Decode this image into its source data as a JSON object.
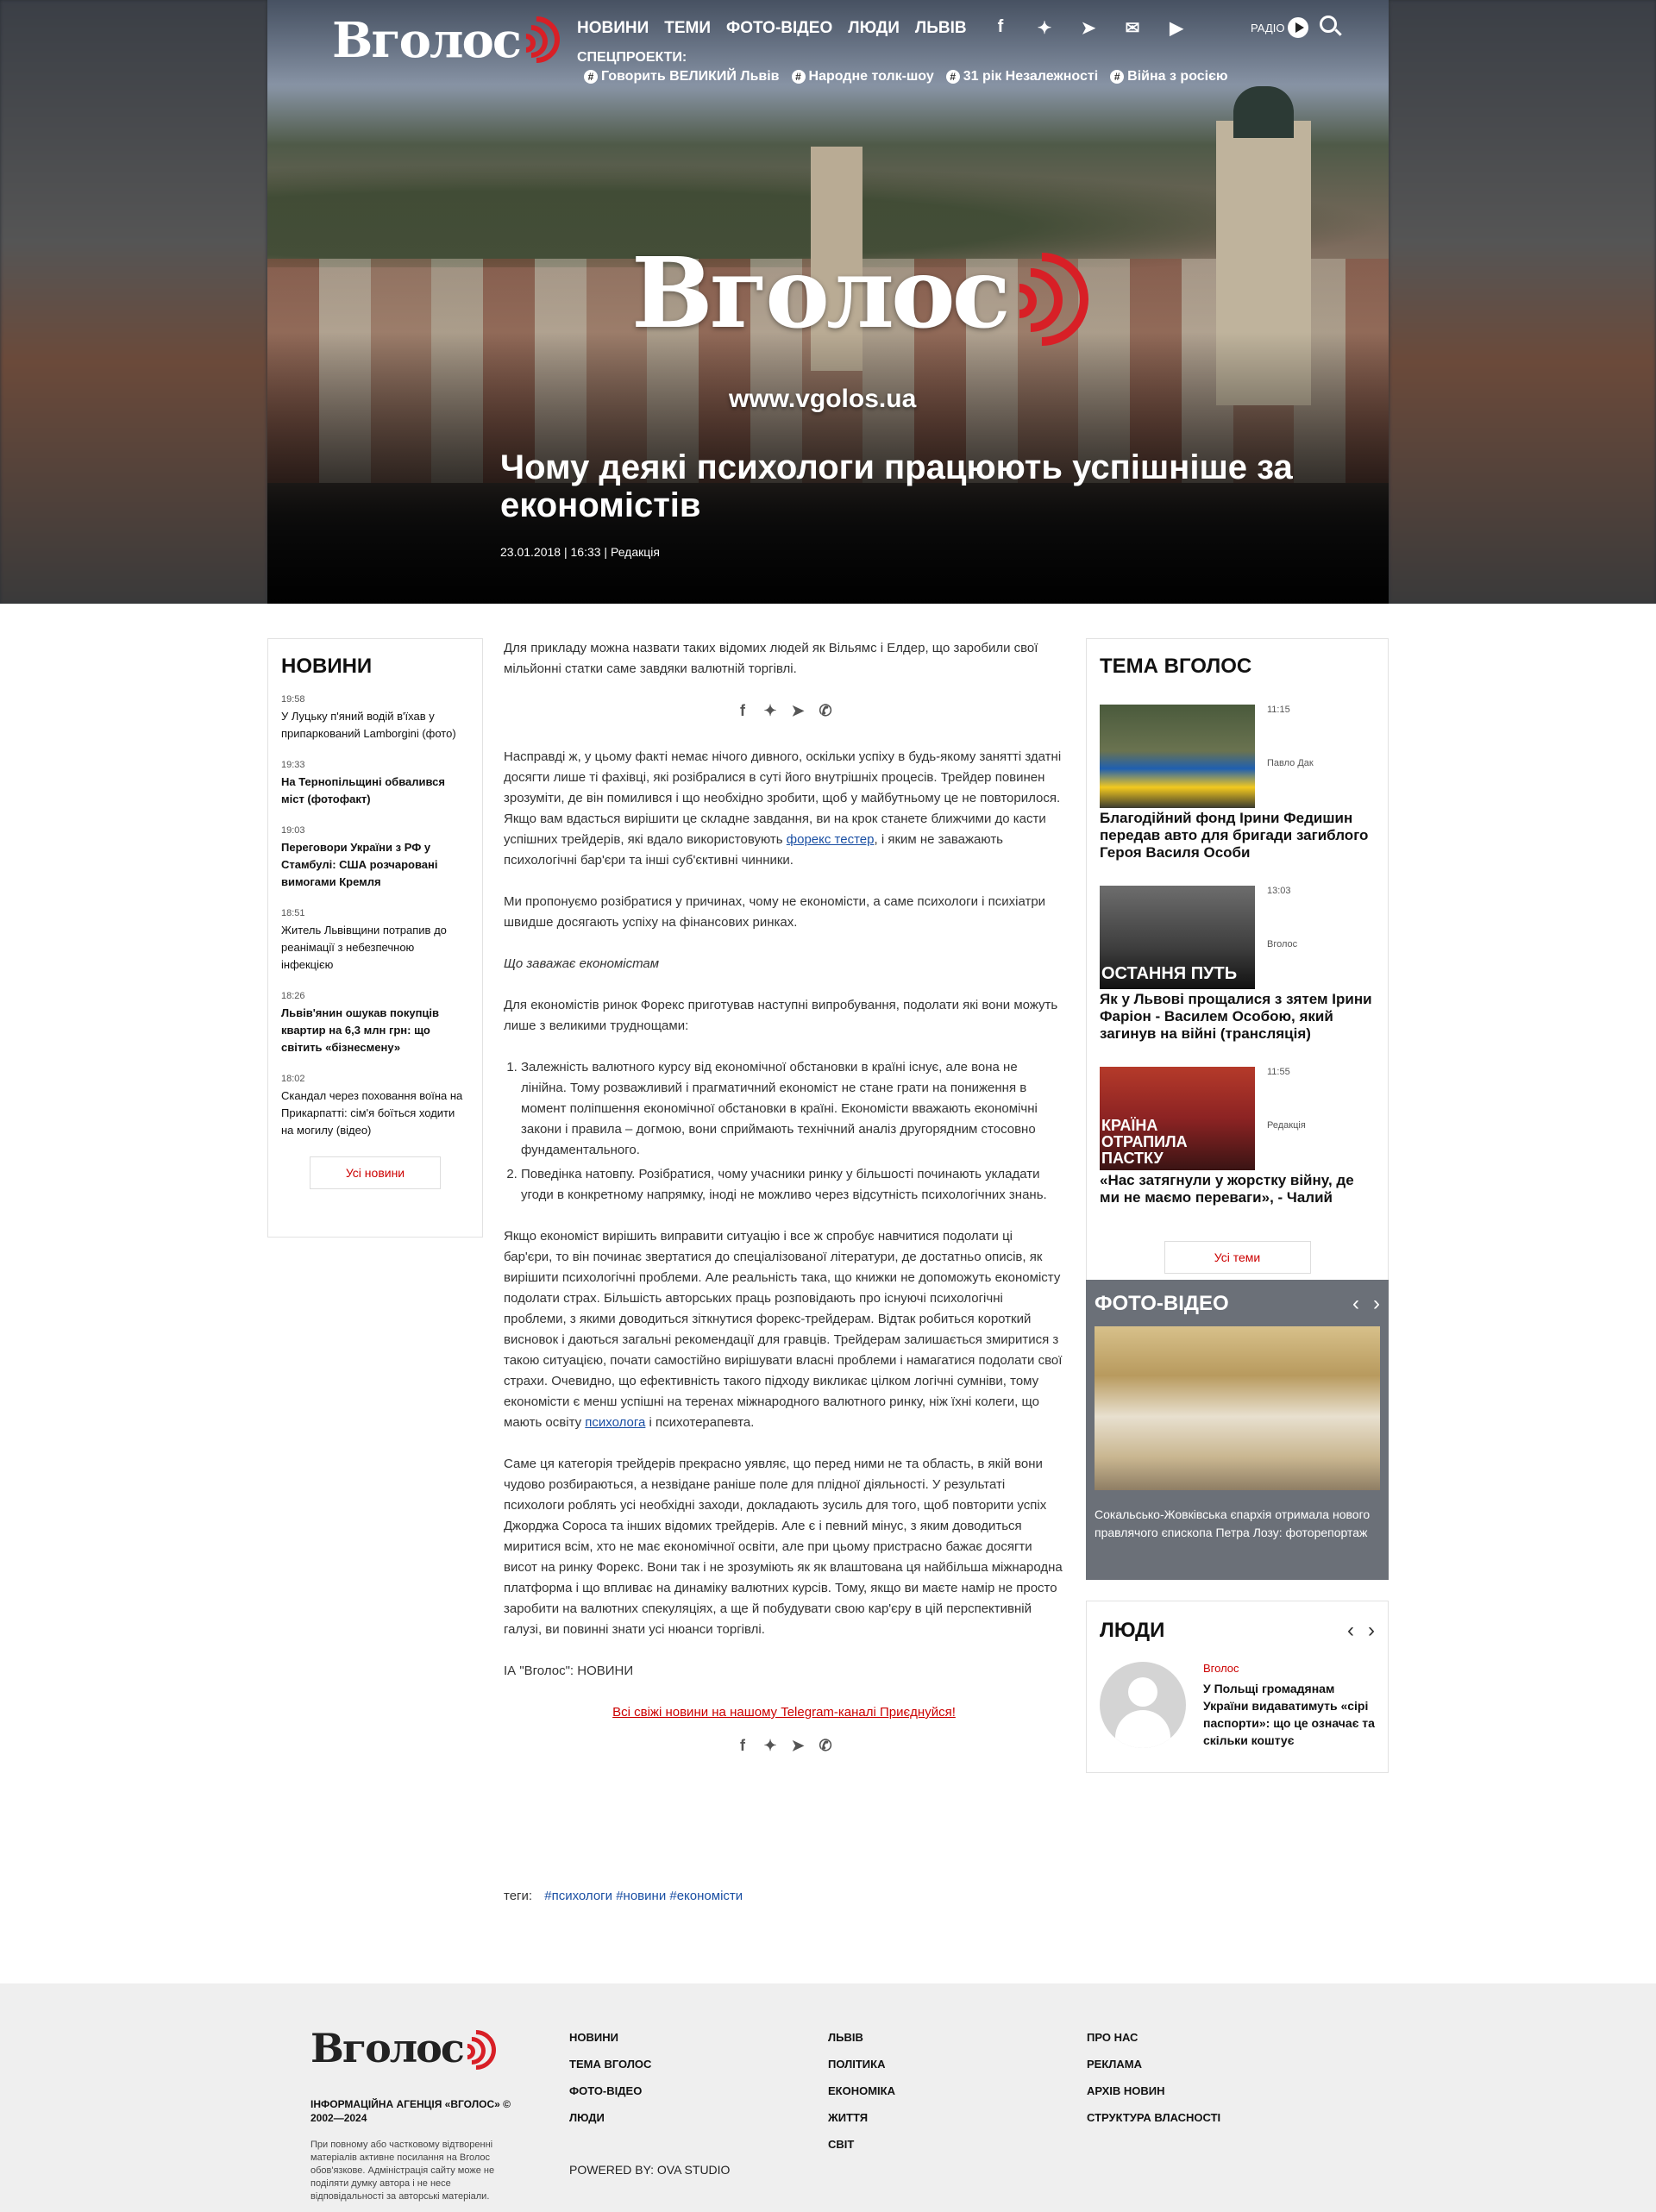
{
  "header": {
    "logo": "Вголос",
    "nav": [
      "Новини",
      "Теми",
      "Фото-відео",
      "Люди",
      "Львів"
    ],
    "social_icons": [
      "facebook-icon",
      "twitter-icon",
      "telegram-icon",
      "mail-icon",
      "youtube-icon"
    ],
    "radio_label": "Радіо",
    "special_label": "Спецпроекти:",
    "special_projects": [
      "Говорить ВЕЛИКИЙ Львів",
      "Народне толк-шоу",
      "31 рік Незалежності",
      "Війна з росією"
    ]
  },
  "hero": {
    "brand": "Вголос",
    "url": "www.vgolos.ua",
    "title": "Чому деякі психологи працюють успішніше за економістів",
    "date": "23.01.2018",
    "time": "16:33",
    "author": "Редакція"
  },
  "news_widget": {
    "title": "Новини",
    "items": [
      {
        "time": "19:58",
        "text": "У Луцьку п'яний водій в'їхав у припаркований Lamborgini (фото)",
        "bold": false
      },
      {
        "time": "19:33",
        "text": "На Тернопільщині обвалився міст (фотофакт)",
        "bold": true
      },
      {
        "time": "19:03",
        "text": "Переговори України з РФ у Стамбулі: США розчаровані вимогами Кремля",
        "bold": true
      },
      {
        "time": "18:51",
        "text": "Житель Львівщини потрапив до реанімації з небезпечною інфекцією",
        "bold": false
      },
      {
        "time": "18:26",
        "text": "Львів'янин ошукав покупців квартир на 6,3 млн грн: що світить «бізнесмену»",
        "bold": true
      },
      {
        "time": "18:02",
        "text": "Скандал через поховання воїна на Прикарпатті: сім'я боїться ходити на могилу (відео)",
        "bold": false
      }
    ],
    "all_label": "Усі новини"
  },
  "article": {
    "p1": "Для прикладу можна назвати таких відомих людей як Вільямс і Елдер, що заробили свої мільйонні статки саме завдяки валютній торгівлі.",
    "p2_a": "Насправді ж, у цьому факті немає нічого дивного, оскільки успіху в будь-якому занятті здатні досягти лише ті фахівці, які розібралися в суті його внутрішніх процесів. Трейдер повинен зрозуміти, де він помилився і що необхідно зробити, щоб у майбутньому це не повторилося. Якщо вам вдасться вирішити це складне завдання, ви на крок станете ближчими до касти успішних трейдерів, які вдало використовують ",
    "p2_link": "форекс тестер",
    "p2_b": ", і яким не заважають психологічні бар'єри та інші суб'єктивні чинники.",
    "p3": "Ми пропонуємо розібратися у причинах, чому не економісти, а саме психологи і психіатри швидше досягають успіху на фінансових ринках.",
    "p4": "Що заважає економістам",
    "p5": "Для економістів ринок Форекс приготував наступні випробування, подолати які вони можуть лише з великими труднощами:",
    "list": [
      "Залежність валютного курсу від економічної обстановки в країні існує, але вона не лінійна. Тому розважливий і прагматичний економіст не стане грати на пониження в момент поліпшення економічної обстановки в країні. Економісти вважають економічні закони і правила – догмою, вони сприймають технічний аналіз другорядним стосовно  фундаментального.",
      "Поведінка натовпу. Розібратися, чому учасники ринку у більшості починають укладати угоди в конкретному напрямку, іноді не можливо через відсутність психологічних знань."
    ],
    "p6_a": "Якщо економіст вирішить виправити ситуацію і все ж спробує навчитися подолати ці бар'єри, то він починає звертатися до спеціалізованої літератури, де достатньо описів, як вирішити психологічні проблеми. Але реальність така, що книжки не допоможуть економісту подолати страх. Більшість авторських праць розповідають про існуючі психологічні проблеми, з якими доводиться зіткнутися форекс-трейдерам. Відтак робиться короткий висновок і даються загальні рекомендації для гравців. Трейдерам залишається змиритися з такою ситуацією, почати самостійно вирішувати власні проблеми і намагатися подолати свої страхи. Очевидно, що ефективність такого підходу викликає цілком логічні сумніви, тому економісти є менш успішні на теренах міжнародного валютного ринку, ніж їхні колеги, що мають освіту ",
    "p6_link": "психолога",
    "p6_b": " і психотерапевта.",
    "p7": "Саме ця категорія трейдерів прекрасно уявляє, що перед ними не та область, в якій вони чудово розбираються, а незвідане раніше поле для плідної діяльності. У результаті психологи роблять усі необхідні заходи, докладають зусиль для того, щоб повторити успіх Джорджа Сороса та інших відомих трейдерів. Але є і певний мінус, з яким доводиться миритися всім, хто не має економічної освіти, але при цьому пристрасно бажає досягти висот на ринку Форекс. Вони так і не зрозуміють як як влаштована ця найбільша міжнародна платформа і що впливає на динаміку валютних курсів. Тому, якщо ви маєте намір не просто заробити на валютних спекуляціях, а ще й побудувати свою кар'єру в цій перспективній галузі, ви повинні знати усі нюанси торгівлі.",
    "p8": "ІА \"Вголос\": НОВИНИ",
    "telegram": "Всі свіжі новини на нашому Telegram-каналі   Приєднуйся!",
    "share_icons": [
      "facebook-icon",
      "twitter-icon",
      "telegram-icon",
      "viber-icon"
    ]
  },
  "tags": {
    "label": "теги:",
    "items": [
      "#психологи",
      "#новини",
      "#економісти"
    ]
  },
  "tema_widget": {
    "title": "Тема Вголос",
    "items": [
      {
        "time": "11:15",
        "author": "Павло Дак",
        "title": "Благодійний фонд Ірини Федишин передав авто для бригади загиблого Героя Василя Особи",
        "img_color": "#4a5a3c"
      },
      {
        "time": "13:03",
        "author": "Вголос",
        "title": "Як у Львові прощалися з зятем Ірини Фаріон - Василем Особою, який загинув на війні (трансляція)",
        "img_color": "#3e3e3e",
        "img_text": "ОСТАННЯ ПУТЬ"
      },
      {
        "time": "11:55",
        "author": "Редакція",
        "title": "«Нас затягнули у жорстку війну, де ми не маємо переваги», - Чалий",
        "img_color": "#8c2323",
        "img_text": "КРАЇНА ОТРАПИЛА ПАСТКУ"
      }
    ],
    "all_label": "Усі теми"
  },
  "photo_widget": {
    "title": "Фото-відео",
    "caption": "Сокальсько-Жовківська єпархія отримала нового правлячого єпископа Петра Лозу: фоторепортаж"
  },
  "people_widget": {
    "title": "Люди",
    "source": "Вголос",
    "headline": "У Польщі громадянам України видаватимуть «сірі паспорти»: що це означає та скільки коштує"
  },
  "footer": {
    "logo": "Вголос",
    "agency": "Інформаційна агенція «Вголос» © 2002—2024",
    "disclaimer": "При повному або частковому відтворенні матеріалів активне посилання на Вголос обов'язкове. Адміністрація сайту може не поділяти думку автора і не несе відповідальності за авторські матеріали.",
    "col1": [
      "Новини",
      "Тема Вголос",
      "Фото-відео",
      "Люди"
    ],
    "col2": [
      "Львів",
      "Політика",
      "Економіка",
      "Життя",
      "Світ"
    ],
    "col3": [
      "Про нас",
      "Реклама",
      "Архів новин",
      "Структура власності"
    ],
    "powered": "POWERED BY: OVA STUDIO"
  }
}
